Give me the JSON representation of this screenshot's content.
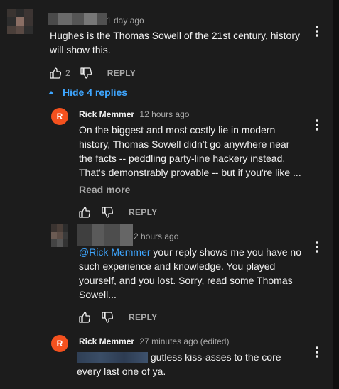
{
  "comments": [
    {
      "id": "top",
      "author": "",
      "time": "1 day ago",
      "text": "Hughes is the Thomas Sowell of the 21st century, history will show this.",
      "likes": "2",
      "reply_label": "REPLY"
    }
  ],
  "toggle_replies": {
    "label": "Hide 4 replies"
  },
  "replies": [
    {
      "avatar_letter": "R",
      "author": "Rick Memmer",
      "time": "12 hours ago",
      "text": "On the biggest and most costly lie in modern history, Thomas Sowell didn't go anywhere near the facts -- peddling party-line hackery instead. That's demonstrably provable -- but if you're like ...",
      "read_more": "Read more",
      "reply_label": "REPLY"
    },
    {
      "author": "",
      "time": "2 hours ago",
      "mention": "@Rick Memmer",
      "text": " your reply shows me you have no such experience and knowledge. You played yourself, and you lost. Sorry, read some Thomas Sowell...",
      "reply_label": "REPLY"
    },
    {
      "avatar_letter": "R",
      "author": "Rick Memmer",
      "time": "27 minutes ago (edited)",
      "text": " gutless kiss-asses to the core — every last one of ya."
    }
  ],
  "colors": {
    "accent": "#3ea6ff",
    "avatar_orange": "#f4511e",
    "background": "#1c1c1c"
  },
  "icons": [
    "thumbs-up-icon",
    "thumbs-down-icon",
    "more-vert-icon",
    "chevron-up-icon"
  ]
}
